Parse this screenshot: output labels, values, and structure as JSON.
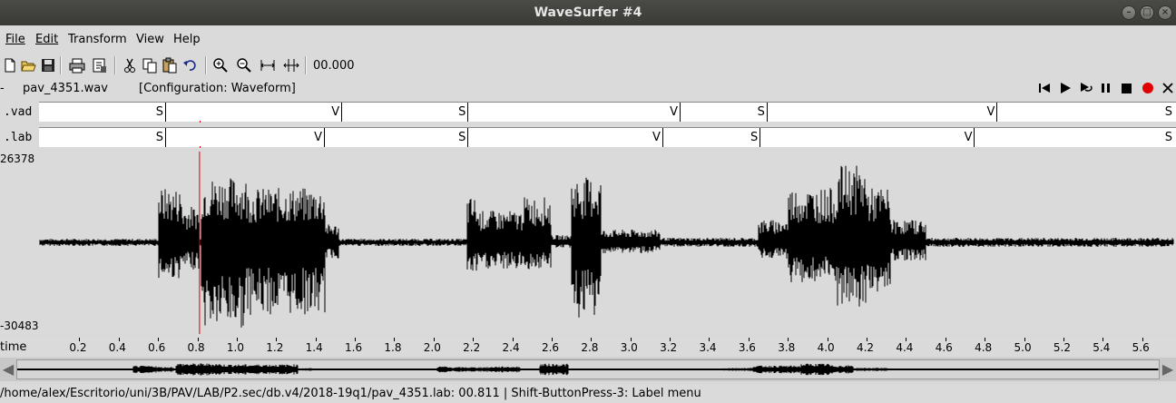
{
  "window": {
    "title": "WaveSurfer #4"
  },
  "menu": [
    {
      "label": "File"
    },
    {
      "label": "Edit"
    },
    {
      "label": "Transform"
    },
    {
      "label": "View"
    },
    {
      "label": "Help"
    }
  ],
  "toolbar": {
    "icons": [
      "new-file-icon",
      "open-folder-icon",
      "save-icon",
      "print-icon",
      "properties-icon",
      "cut-icon",
      "copy-icon",
      "paste-icon",
      "undo-icon",
      "zoom-in-icon",
      "zoom-out-icon",
      "zoom-fit-icon",
      "zoom-selection-icon"
    ],
    "time_readout": "00.000"
  },
  "filebar": {
    "dash": "-",
    "filename": "pav_4351.wav",
    "configuration": "[Configuration: Waveform]",
    "transport": [
      "rewind-icon",
      "play-icon",
      "play-loop-icon",
      "pause-icon",
      "stop-icon",
      "record-icon",
      "close-icon"
    ]
  },
  "tiers": [
    {
      "name": ".vad",
      "segments": [
        {
          "label": "S",
          "end": 0.641
        },
        {
          "label": "V",
          "end": 1.536
        },
        {
          "label": "S",
          "end": 2.178
        },
        {
          "label": "V",
          "end": 3.255
        },
        {
          "label": "S",
          "end": 3.697
        },
        {
          "label": "V",
          "end": 4.866
        },
        {
          "label": "S",
          "end": 5.9
        }
      ]
    },
    {
      "name": ".lab",
      "segments": [
        {
          "label": "S",
          "end": 0.641
        },
        {
          "label": "V",
          "end": 1.448
        },
        {
          "label": "S",
          "end": 2.178
        },
        {
          "label": "V",
          "end": 3.167
        },
        {
          "label": "S",
          "end": 3.662
        },
        {
          "label": "V",
          "end": 4.751
        },
        {
          "label": "S",
          "end": 5.9
        }
      ]
    }
  ],
  "waveform": {
    "ymax_label": "26378",
    "ymin_label": "-30483",
    "cursor_time": 0.811
  },
  "time_axis": {
    "label": "time",
    "ticks": [
      "0.2",
      "0.4",
      "0.6",
      "0.8",
      "1.0",
      "1.2",
      "1.4",
      "1.6",
      "1.8",
      "2.0",
      "2.2",
      "2.4",
      "2.6",
      "2.8",
      "3.0",
      "3.2",
      "3.4",
      "3.6",
      "3.8",
      "4.0",
      "4.2",
      "4.4",
      "4.6",
      "4.8",
      "5.0",
      "5.2",
      "5.4",
      "5.6"
    ]
  },
  "statusbar": {
    "text": "/home/alex/Escritorio/uni/3B/PAV/LAB/P2.sec/db.v4/2018-19q1/pav_4351.lab: 00.811 | Shift-ButtonPress-3: Label menu"
  }
}
